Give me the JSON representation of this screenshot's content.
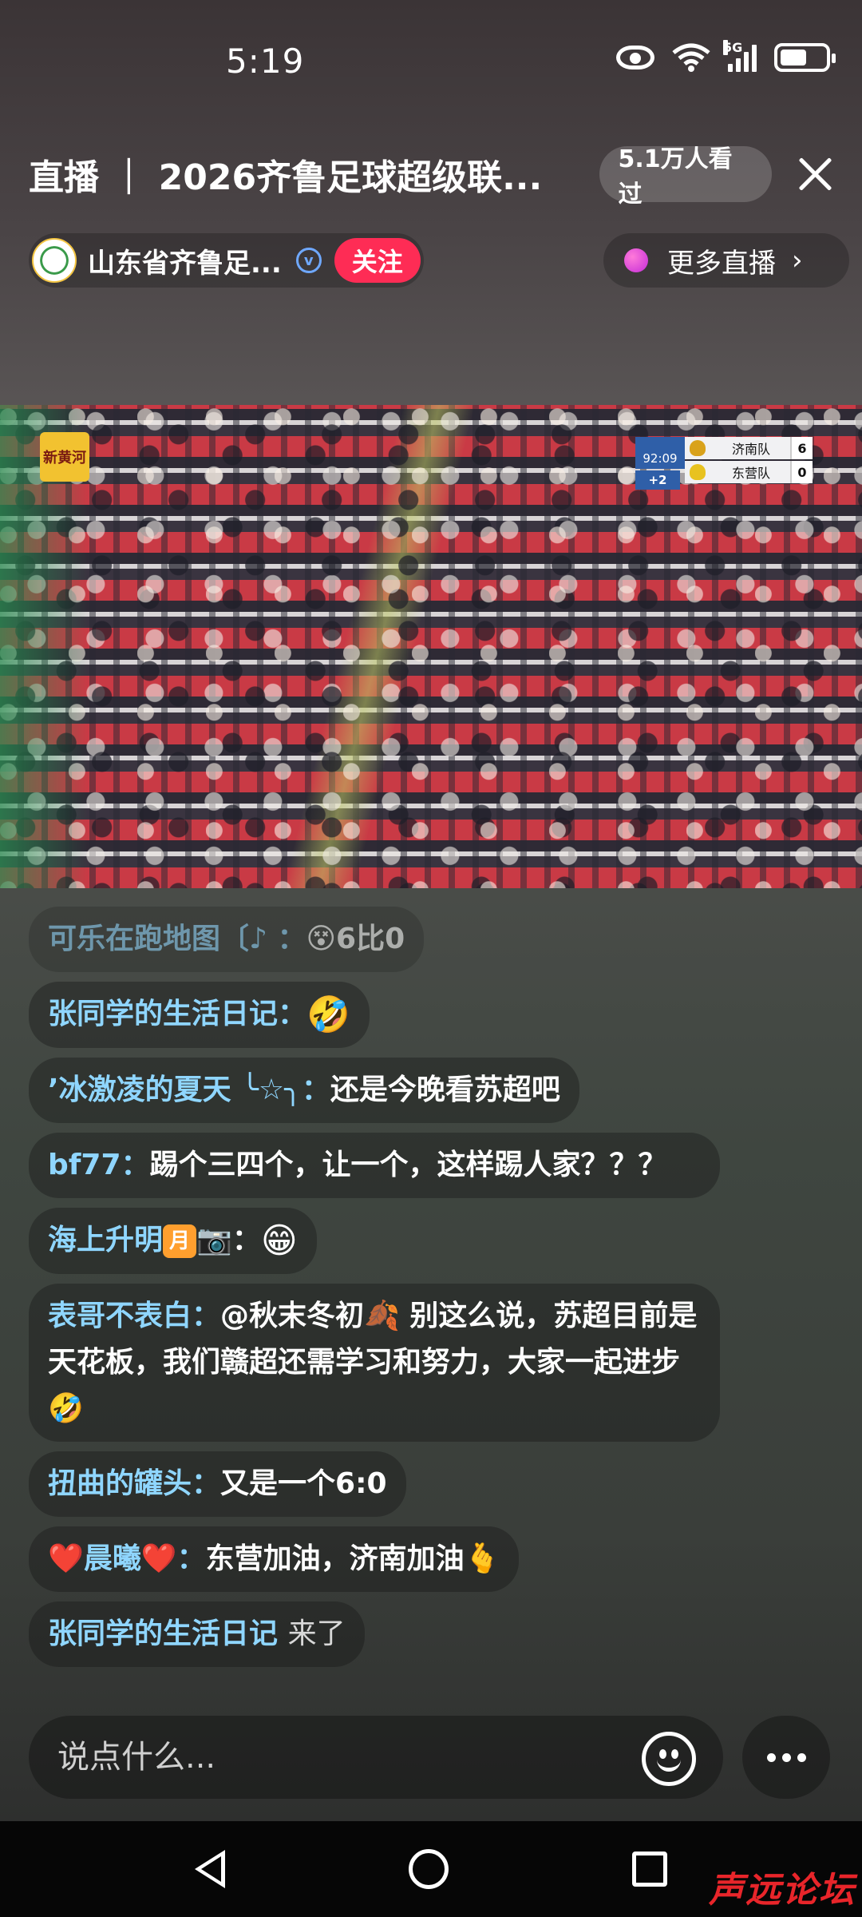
{
  "status": {
    "time": "5:19",
    "network": "5G",
    "icons": [
      "eye-icon",
      "wifi-icon",
      "signal-icon",
      "battery-icon"
    ]
  },
  "header": {
    "title": "直播 ｜ 2026齐鲁足球超级联...",
    "viewers": "5.1万人看过",
    "close_icon": "close-icon"
  },
  "host": {
    "name": "山东省齐鲁足...",
    "verified_mark": "v",
    "follow_label": "关注"
  },
  "more_live": {
    "label": "更多直播",
    "chevron": "›"
  },
  "video": {
    "channel_logo": "新黄河",
    "scoreboard": {
      "clock": "92:09",
      "added_time": "+2",
      "teams": [
        {
          "name": "济南队",
          "score": "6",
          "crest_color": "#d9a21b"
        },
        {
          "name": "东营队",
          "score": "0",
          "crest_color": "#e8c21f"
        }
      ]
    }
  },
  "comments": [
    {
      "user": "可乐在跑地图〔♪ ：",
      "text": "😵6比0",
      "faded": true
    },
    {
      "user": "张同学的生活日记：",
      "text": "🤣"
    },
    {
      "user": "’冰激凌的夏天 ╰☆╮：",
      "text": "还是今晚看苏超吧"
    },
    {
      "user": "bf77：",
      "text": "踢个三四个，让一个，这样踢人家？？？"
    },
    {
      "user": "海上升明",
      "badge": "月",
      "extra": "📷：",
      "text": "😁"
    },
    {
      "user": "表哥不表白：",
      "text": "@秋末冬初🍂 别这么说，苏超目前是天花板，我们赣超还需学习和努力，大家一起进步🤣"
    },
    {
      "user": "扭曲的罐头：",
      "text": "又是一个6:0"
    },
    {
      "user": "❤️晨曦❤️：",
      "text": "东营加油，济南加油🫰"
    },
    {
      "user": "张同学的生活日记",
      "system": "来了"
    }
  ],
  "input": {
    "placeholder": "说点什么..."
  },
  "watermark": "声远论坛",
  "colors": {
    "follow": "#fe2c55",
    "username": "#8fd6ff",
    "scoreboard_blue": "#2f5fa8"
  }
}
